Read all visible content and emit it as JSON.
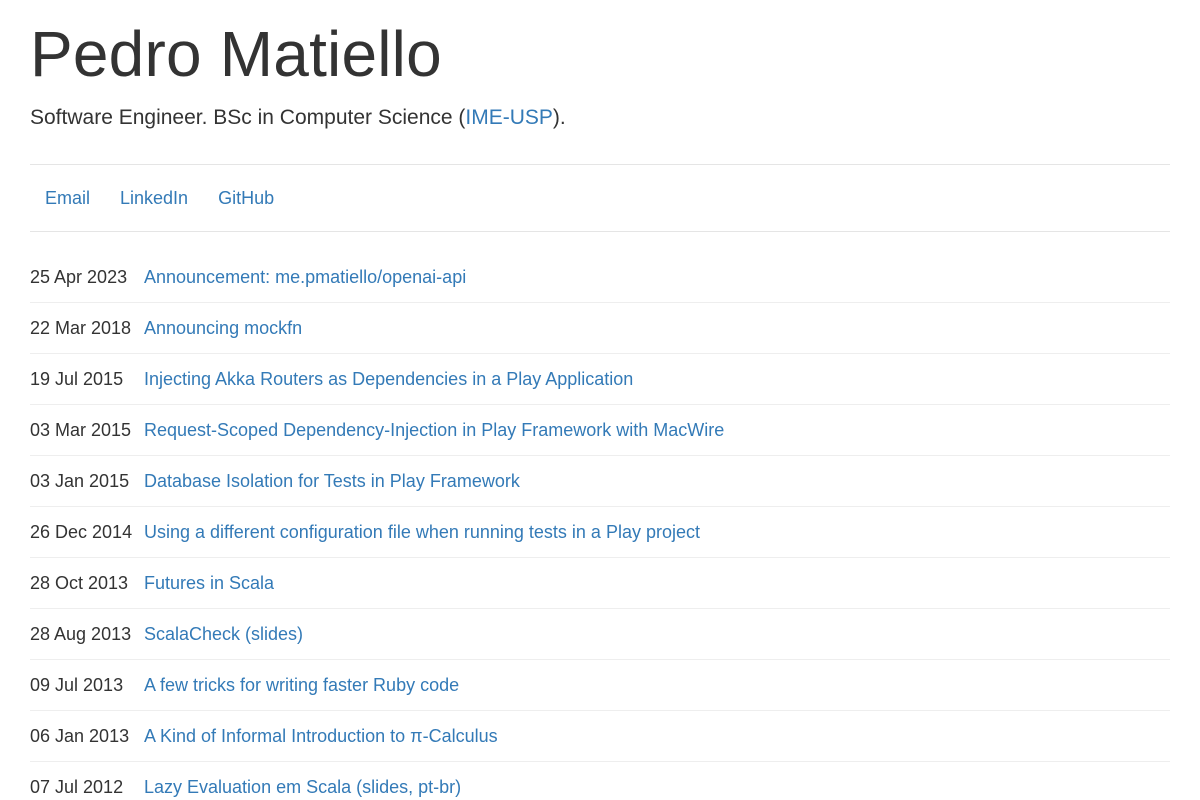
{
  "header": {
    "name": "Pedro Matiello",
    "subtitle_pre": "Software Engineer. BSc in Computer Science (",
    "subtitle_link": "IME-USP",
    "subtitle_post": ")."
  },
  "nav": {
    "items": [
      {
        "label": "Email"
      },
      {
        "label": "LinkedIn"
      },
      {
        "label": "GitHub"
      }
    ]
  },
  "posts": [
    {
      "date": "25 Apr 2023",
      "title": "Announcement: me.pmatiello/openai-api"
    },
    {
      "date": "22 Mar 2018",
      "title": "Announcing mockfn"
    },
    {
      "date": "19 Jul 2015",
      "title": "Injecting Akka Routers as Dependencies in a Play Application"
    },
    {
      "date": "03 Mar 2015",
      "title": "Request-Scoped Dependency-Injection in Play Framework with MacWire"
    },
    {
      "date": "03 Jan 2015",
      "title": "Database Isolation for Tests in Play Framework"
    },
    {
      "date": "26 Dec 2014",
      "title": "Using a different configuration file when running tests in a Play project"
    },
    {
      "date": "28 Oct 2013",
      "title": "Futures in Scala"
    },
    {
      "date": "28 Aug 2013",
      "title": "ScalaCheck (slides)"
    },
    {
      "date": "09 Jul 2013",
      "title": "A few tricks for writing faster Ruby code"
    },
    {
      "date": "06 Jan 2013",
      "title": "A Kind of Informal Introduction to π-Calculus"
    },
    {
      "date": "07 Jul 2012",
      "title": "Lazy Evaluation em Scala (slides, pt-br)"
    }
  ],
  "colors": {
    "link": "#337ab7",
    "text": "#333333",
    "divider": "#e5e5e5"
  }
}
